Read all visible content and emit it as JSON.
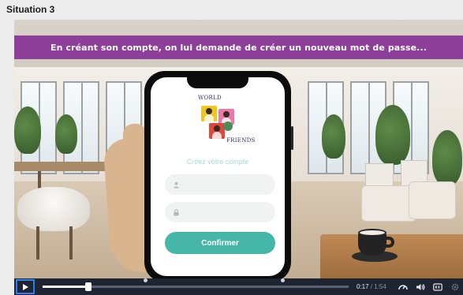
{
  "page": {
    "title": "Situation 3"
  },
  "banner": {
    "text": "En créant son compte, on lui demande de créer un nouveau mot  de passe..."
  },
  "app": {
    "logo_line1": "WORLD",
    "logo_line2": "FRIENDS",
    "create_account_title": "Créez votre compte",
    "confirm_label": "Confirmer"
  },
  "player": {
    "current_time": "0:17",
    "separator": " / ",
    "duration": "1:54",
    "progress_fraction": 0.149,
    "accent_color": "#2d7ff0"
  },
  "colors": {
    "banner": "#8e3f9a",
    "confirm_button": "#45b6a8",
    "player_bg": "#1f2433"
  },
  "icons": [
    "user-icon",
    "lock-icon",
    "play-icon",
    "speed-icon",
    "volume-icon",
    "captions-icon",
    "settings-icon"
  ]
}
